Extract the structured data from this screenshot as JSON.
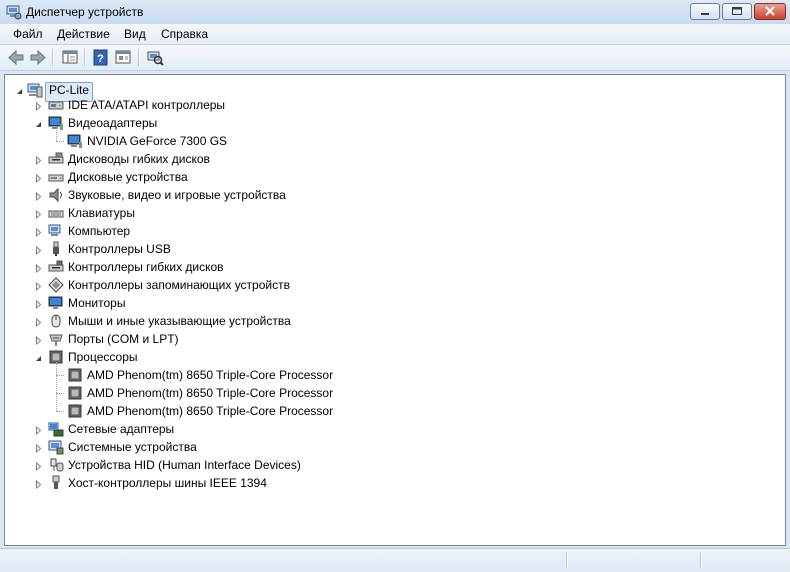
{
  "window": {
    "title": "Диспетчер устройств"
  },
  "menu": [
    {
      "label": "Файл"
    },
    {
      "label": "Действие"
    },
    {
      "label": "Вид"
    },
    {
      "label": "Справка"
    }
  ],
  "tree": {
    "root": {
      "label": "PC-Lite",
      "expanded": true
    },
    "nodes": [
      {
        "label": "IDE ATA/ATAPI контроллеры",
        "icon": "ide-controller-icon",
        "expanded": false,
        "children": []
      },
      {
        "label": "Видеоадаптеры",
        "icon": "display-adapter-icon",
        "expanded": true,
        "children": [
          {
            "label": "NVIDIA GeForce 7300 GS",
            "icon": "display-adapter-icon"
          }
        ]
      },
      {
        "label": "Дисководы гибких дисков",
        "icon": "floppy-drive-icon",
        "expanded": false,
        "children": []
      },
      {
        "label": "Дисковые устройства",
        "icon": "disk-drive-icon",
        "expanded": false,
        "children": []
      },
      {
        "label": "Звуковые, видео и игровые устройства",
        "icon": "speaker-icon",
        "expanded": false,
        "children": []
      },
      {
        "label": "Клавиатуры",
        "icon": "keyboard-icon",
        "expanded": false,
        "children": []
      },
      {
        "label": "Компьютер",
        "icon": "computer-icon",
        "expanded": false,
        "children": []
      },
      {
        "label": "Контроллеры USB",
        "icon": "usb-icon",
        "expanded": false,
        "children": []
      },
      {
        "label": "Контроллеры гибких дисков",
        "icon": "floppy-controller-icon",
        "expanded": false,
        "children": []
      },
      {
        "label": "Контроллеры запоминающих устройств",
        "icon": "storage-controller-icon",
        "expanded": false,
        "children": []
      },
      {
        "label": "Мониторы",
        "icon": "monitor-icon",
        "expanded": false,
        "children": []
      },
      {
        "label": "Мыши и иные указывающие устройства",
        "icon": "mouse-icon",
        "expanded": false,
        "children": []
      },
      {
        "label": "Порты (COM и LPT)",
        "icon": "port-icon",
        "expanded": false,
        "children": []
      },
      {
        "label": "Процессоры",
        "icon": "processor-icon",
        "expanded": true,
        "children": [
          {
            "label": "AMD Phenom(tm) 8650 Triple-Core Processor",
            "icon": "processor-icon"
          },
          {
            "label": "AMD Phenom(tm) 8650 Triple-Core Processor",
            "icon": "processor-icon"
          },
          {
            "label": "AMD Phenom(tm) 8650 Triple-Core Processor",
            "icon": "processor-icon"
          }
        ]
      },
      {
        "label": "Сетевые адаптеры",
        "icon": "network-adapter-icon",
        "expanded": false,
        "children": []
      },
      {
        "label": "Системные устройства",
        "icon": "system-devices-icon",
        "expanded": false,
        "children": []
      },
      {
        "label": "Устройства HID (Human Interface Devices)",
        "icon": "hid-icon",
        "expanded": false,
        "children": []
      },
      {
        "label": "Хост-контроллеры шины IEEE 1394",
        "icon": "ieee1394-icon",
        "expanded": false,
        "children": []
      }
    ]
  }
}
